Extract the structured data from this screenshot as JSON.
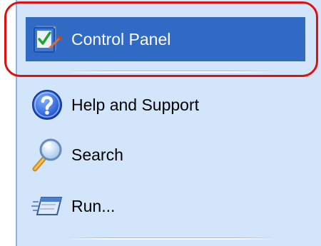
{
  "menu": {
    "items": [
      {
        "label": "Control Panel",
        "icon": "control-panel-icon",
        "highlighted": true
      },
      {
        "label": "Help and Support",
        "icon": "help-icon",
        "highlighted": false
      },
      {
        "label": "Search",
        "icon": "search-icon",
        "highlighted": false
      },
      {
        "label": "Run...",
        "icon": "run-icon",
        "highlighted": false
      }
    ]
  },
  "colors": {
    "panel_background": "#d3e5fa",
    "highlight": "#316ac5",
    "annotation_ring": "#e01010"
  }
}
